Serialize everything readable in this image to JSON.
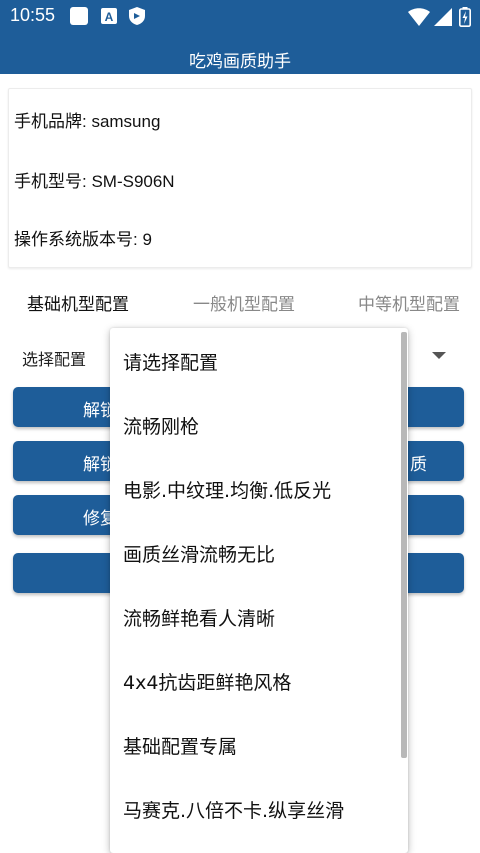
{
  "status_bar": {
    "time": "10:55",
    "icons": [
      "app-icon",
      "a-icon",
      "shield-icon",
      "wifi-icon",
      "signal-icon",
      "battery-icon"
    ]
  },
  "app_bar": {
    "title": "吃鸡画质助手"
  },
  "device_info": {
    "brand": "手机品牌: samsung",
    "model": "手机型号: SM-S906N",
    "os_version": "操作系统版本号: 9"
  },
  "tabs": [
    {
      "label": "基础机型配置",
      "active": true
    },
    {
      "label": "一般机型配置",
      "active": false
    },
    {
      "label": "中等机型配置",
      "active": false
    }
  ],
  "select": {
    "label": "选择配置"
  },
  "buttons": [
    {
      "left_text": "解锁",
      "right_text": ""
    },
    {
      "left_text": "解锁",
      "right_text": "质"
    },
    {
      "left_text": "修复",
      "right_text": ""
    },
    {
      "left_text": "",
      "right_text": ""
    }
  ],
  "dropdown": {
    "options": [
      "请选择配置",
      "流畅刚枪",
      "电影.中纹理.均衡.低反光",
      "画质丝滑流畅无比",
      "流畅鲜艳看人清晰",
      "4x4抗齿距鲜艳风格",
      "基础配置专属",
      "马赛克.八倍不卡.纵享丝滑"
    ]
  },
  "colors": {
    "primary": "#1e5d99",
    "text": "#111111",
    "muted": "#888888"
  }
}
